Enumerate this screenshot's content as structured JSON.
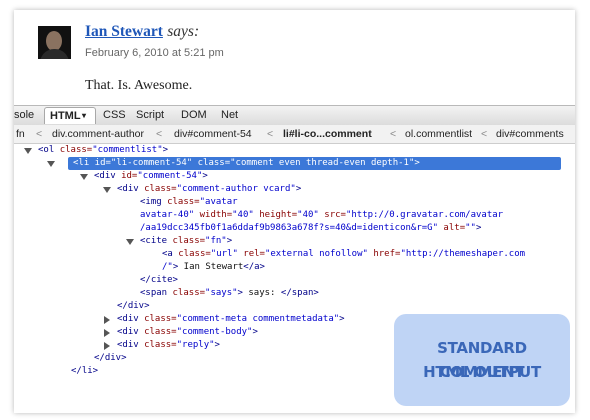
{
  "comment": {
    "author": "Ian Stewart",
    "says": "says:",
    "date": "February 6, 2010 at 5:21 pm",
    "text": "That. Is. Awesome."
  },
  "devtools": {
    "tabs": [
      {
        "label": "sole"
      },
      {
        "label": "HTML",
        "active": true
      },
      {
        "label": "CSS"
      },
      {
        "label": "Script"
      },
      {
        "label": "DOM"
      },
      {
        "label": "Net"
      }
    ],
    "html_tab_arrow": "▾",
    "breadcrumbs": [
      "fn",
      "div.comment-author",
      "div#comment-54",
      "li#li-co...comment",
      "ol.commentlist",
      "div#comments"
    ],
    "breadcrumb_sep": "<",
    "tree": {
      "r0": {
        "open": "<ol ",
        "a1": "class=",
        "v1": "\"commentlist\"",
        "close": ">"
      },
      "r1": "<li id=\"li-comment-54\" class=\"comment even thread-even depth-1\">",
      "r2": {
        "open": "<div ",
        "a1": "id=",
        "v1": "\"comment-54\"",
        "close": ">"
      },
      "r3": {
        "open": "<div ",
        "a1": "class=",
        "v1": "\"comment-author vcard\"",
        "close": ">"
      },
      "r4": {
        "open": "<img ",
        "a1": "class=",
        "v1": "\"avatar"
      },
      "r5": {
        "v1": "avatar-40\"",
        "a2": " width=",
        "v2": "\"40\"",
        "a3": " height=",
        "v3": "\"40\"",
        "a4": " src=",
        "v4": "\"http://0.gravatar.com/avatar"
      },
      "r6": {
        "v1": "/aa19dcc345fb0f1a6ddaf9b9863a678f?s=40&d=identicon&r=G\"",
        "a2": " alt=",
        "v2": "\"\"",
        "close": ">"
      },
      "r7": {
        "open": "<cite ",
        "a1": "class=",
        "v1": "\"fn\"",
        "close": ">"
      },
      "r8": {
        "open": "<a ",
        "a1": "class=",
        "v1": "\"url\"",
        "a2": " rel=",
        "v2": "\"external nofollow\"",
        "a3": " href=",
        "v3": "\"http://themeshaper.com"
      },
      "r9": {
        "v1": "/\"",
        "close": ">",
        "txt": " Ian Stewart",
        "end": "</a>"
      },
      "r10": "</cite>",
      "r11": {
        "open": "<span ",
        "a1": "class=",
        "v1": "\"says\"",
        "close": ">",
        "txt": " says: ",
        "end": "</span>"
      },
      "r12": "</div>",
      "r13": {
        "open": "<div ",
        "a1": "class=",
        "v1": "\"comment-meta commentmetadata\"",
        "close": ">"
      },
      "r14": {
        "open": "<div ",
        "a1": "class=",
        "v1": "\"comment-body\"",
        "close": ">"
      },
      "r15": {
        "open": "<div ",
        "a1": "class=",
        "v1": "\"reply\"",
        "close": ">"
      },
      "r16": "</div>",
      "r17": "</li>"
    }
  },
  "callout": {
    "line1": "STANDARD COMMENT",
    "line2": "HTML OUTPUT"
  }
}
